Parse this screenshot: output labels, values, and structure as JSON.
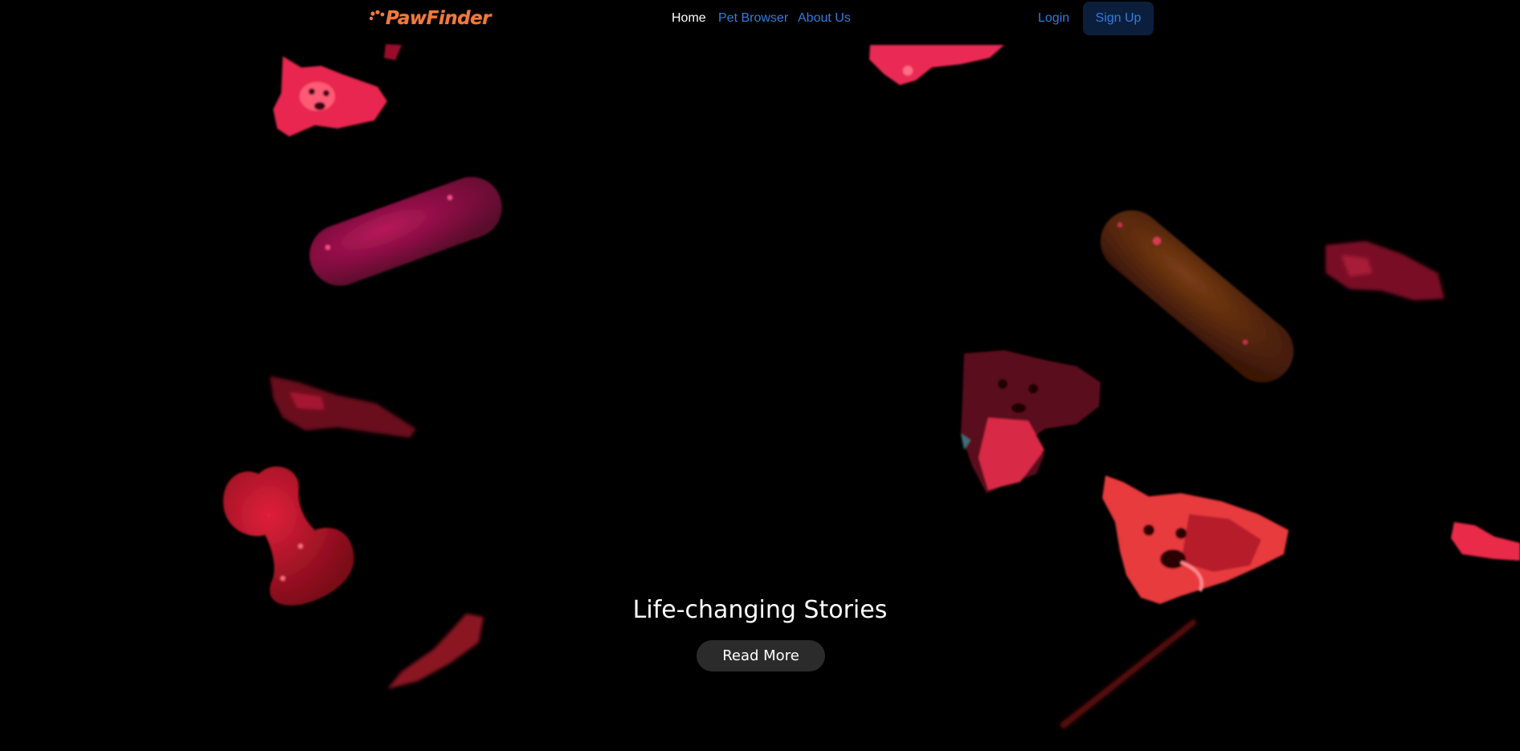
{
  "brand": {
    "name": "PawFinder",
    "color": "#f07a3c"
  },
  "nav": {
    "home": "Home",
    "pet_browser": "Pet Browser",
    "about_us": "About Us",
    "login": "Login",
    "sign_up": "Sign Up",
    "active_color": "#ffffff",
    "link_color": "#2f7de1"
  },
  "hero": {
    "title": "Life-changing Stories",
    "button_label": "Read More",
    "background_color": "#000000"
  },
  "icons": {
    "logo_mark": "paw-icon"
  }
}
